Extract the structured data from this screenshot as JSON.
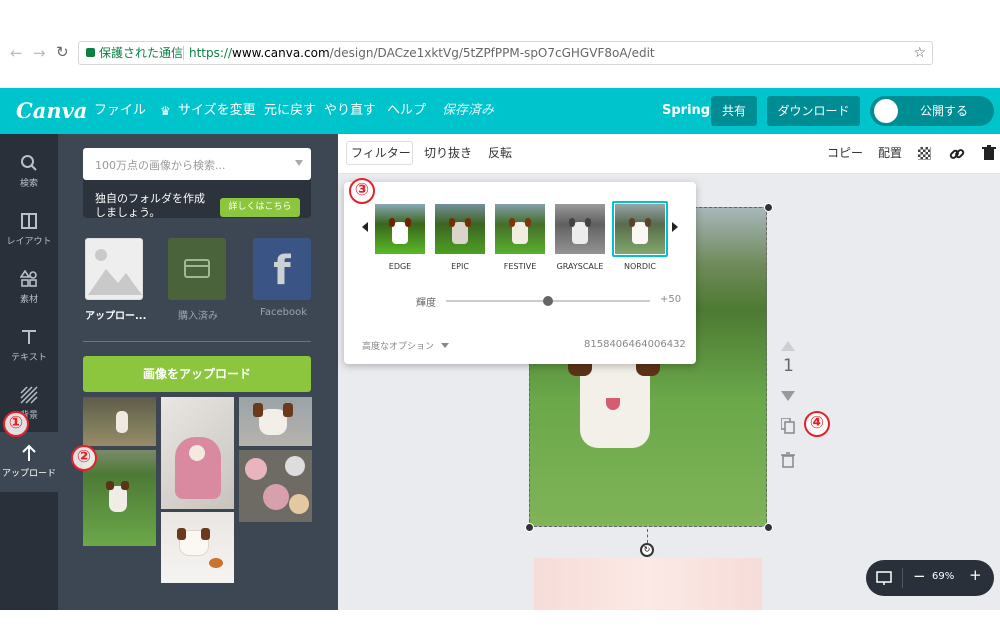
{
  "browser": {
    "secure_label": "保護された通信",
    "url_prefix": "https://",
    "url_host": "www.canva.com",
    "url_path": "/design/DACze1xktVg/5tZPfPPM-spO7cGHGVF8oA/edit"
  },
  "appbar": {
    "logo": "Canva",
    "menu": [
      "ファイル",
      "サイズを変更",
      "元に戻す",
      "やり直す",
      "ヘルプ"
    ],
    "saved_label": "保存済み",
    "team_name": "Spring",
    "share_label": "共有",
    "download_label": "ダウンロード",
    "publish_label": "公開する"
  },
  "sidebar": {
    "items": [
      "検索",
      "レイアウト",
      "素材",
      "テキスト",
      "背景",
      "アップロード"
    ]
  },
  "panel": {
    "search_placeholder": "100万点の画像から検索...",
    "promo_text_1": "独自のフォルダを作成",
    "promo_text_2": "しましょう。",
    "promo_button": "詳しくはこちら",
    "sources": [
      "アップロー...",
      "購入済み",
      "Facebook"
    ],
    "upload_button": "画像をアップロード"
  },
  "toolbar": {
    "left": [
      "フィルター",
      "切り抜き",
      "反転"
    ],
    "copy_label": "コピー",
    "arrange_label": "配置"
  },
  "filter_popup": {
    "filters": [
      "EDGE",
      "EPIC",
      "FESTIVE",
      "GRAYSCALE",
      "NORDIC"
    ],
    "selected": "NORDIC",
    "slider_label": "輝度",
    "slider_value": "+50",
    "slider_fraction": 0.5,
    "advanced_label": "高度なオプション",
    "code": "8158406464006432"
  },
  "page_controls": {
    "page_number": "1"
  },
  "zoom": {
    "value": "69%",
    "minus": "−",
    "plus": "+"
  },
  "annotations": [
    "①",
    "②",
    "③",
    "④"
  ],
  "colors": {
    "brand": "#00c4cc",
    "brand_dark": "#008c93",
    "panel": "#3d4753",
    "sidebar": "#293039",
    "upload_button": "#8cc63f",
    "annotation_red": "#e8202a"
  }
}
